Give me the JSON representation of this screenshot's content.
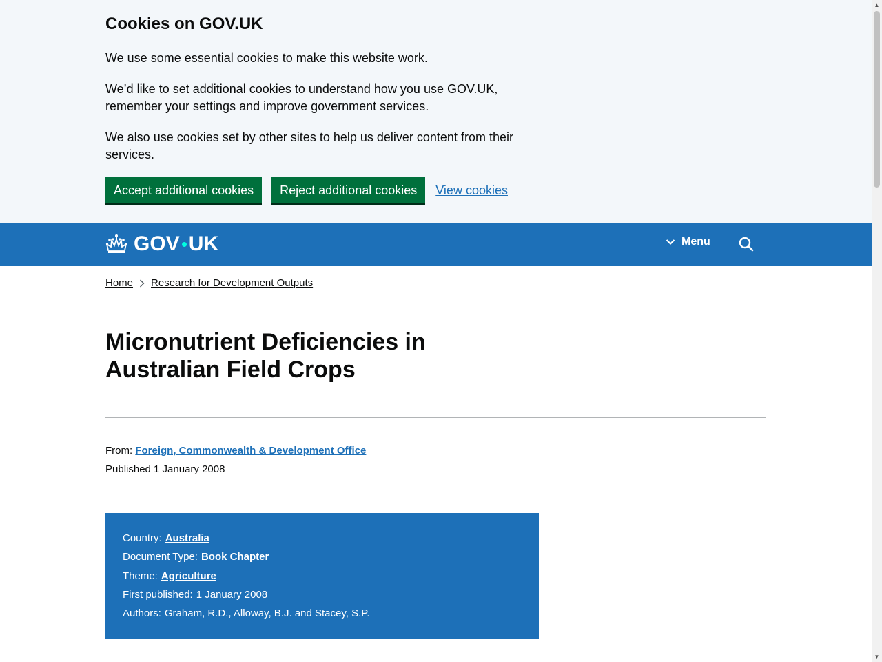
{
  "cookie_banner": {
    "title": "Cookies on GOV.UK",
    "paragraphs": [
      "We use some essential cookies to make this website work.",
      "We’d like to set additional cookies to understand how you use GOV.UK, remember your settings and improve government services.",
      "We also use cookies set by other sites to help us deliver content from their services."
    ],
    "accept_label": "Accept additional cookies",
    "reject_label": "Reject additional cookies",
    "view_label": "View cookies"
  },
  "header": {
    "logo_left": "GOV",
    "logo_right": "UK",
    "menu_label": "Menu",
    "brand_color": "#1d70b8",
    "dot_color": "#00ffe0"
  },
  "breadcrumbs": [
    {
      "label": "Home"
    },
    {
      "label": "Research for Development Outputs"
    }
  ],
  "page": {
    "title": "Micronutrient Deficiencies in Australian Field Crops",
    "from_label": "From:",
    "from_org": "Foreign, Commonwealth & Development Office",
    "published": "Published 1 January 2008"
  },
  "details": {
    "country_label": "Country:",
    "country_value": "Australia",
    "doctype_label": "Document Type:",
    "doctype_value": "Book Chapter",
    "theme_label": "Theme:",
    "theme_value": "Agriculture",
    "first_published_label": "First published:",
    "first_published_value": "1 January 2008",
    "authors_label": "Authors:",
    "authors_value": "Graham, R.D., Alloway, B.J. and Stacey, S.P."
  },
  "colors": {
    "button_green": "#00703c",
    "link_blue": "#1d70b8",
    "banner_bg": "#f3f7fa"
  }
}
